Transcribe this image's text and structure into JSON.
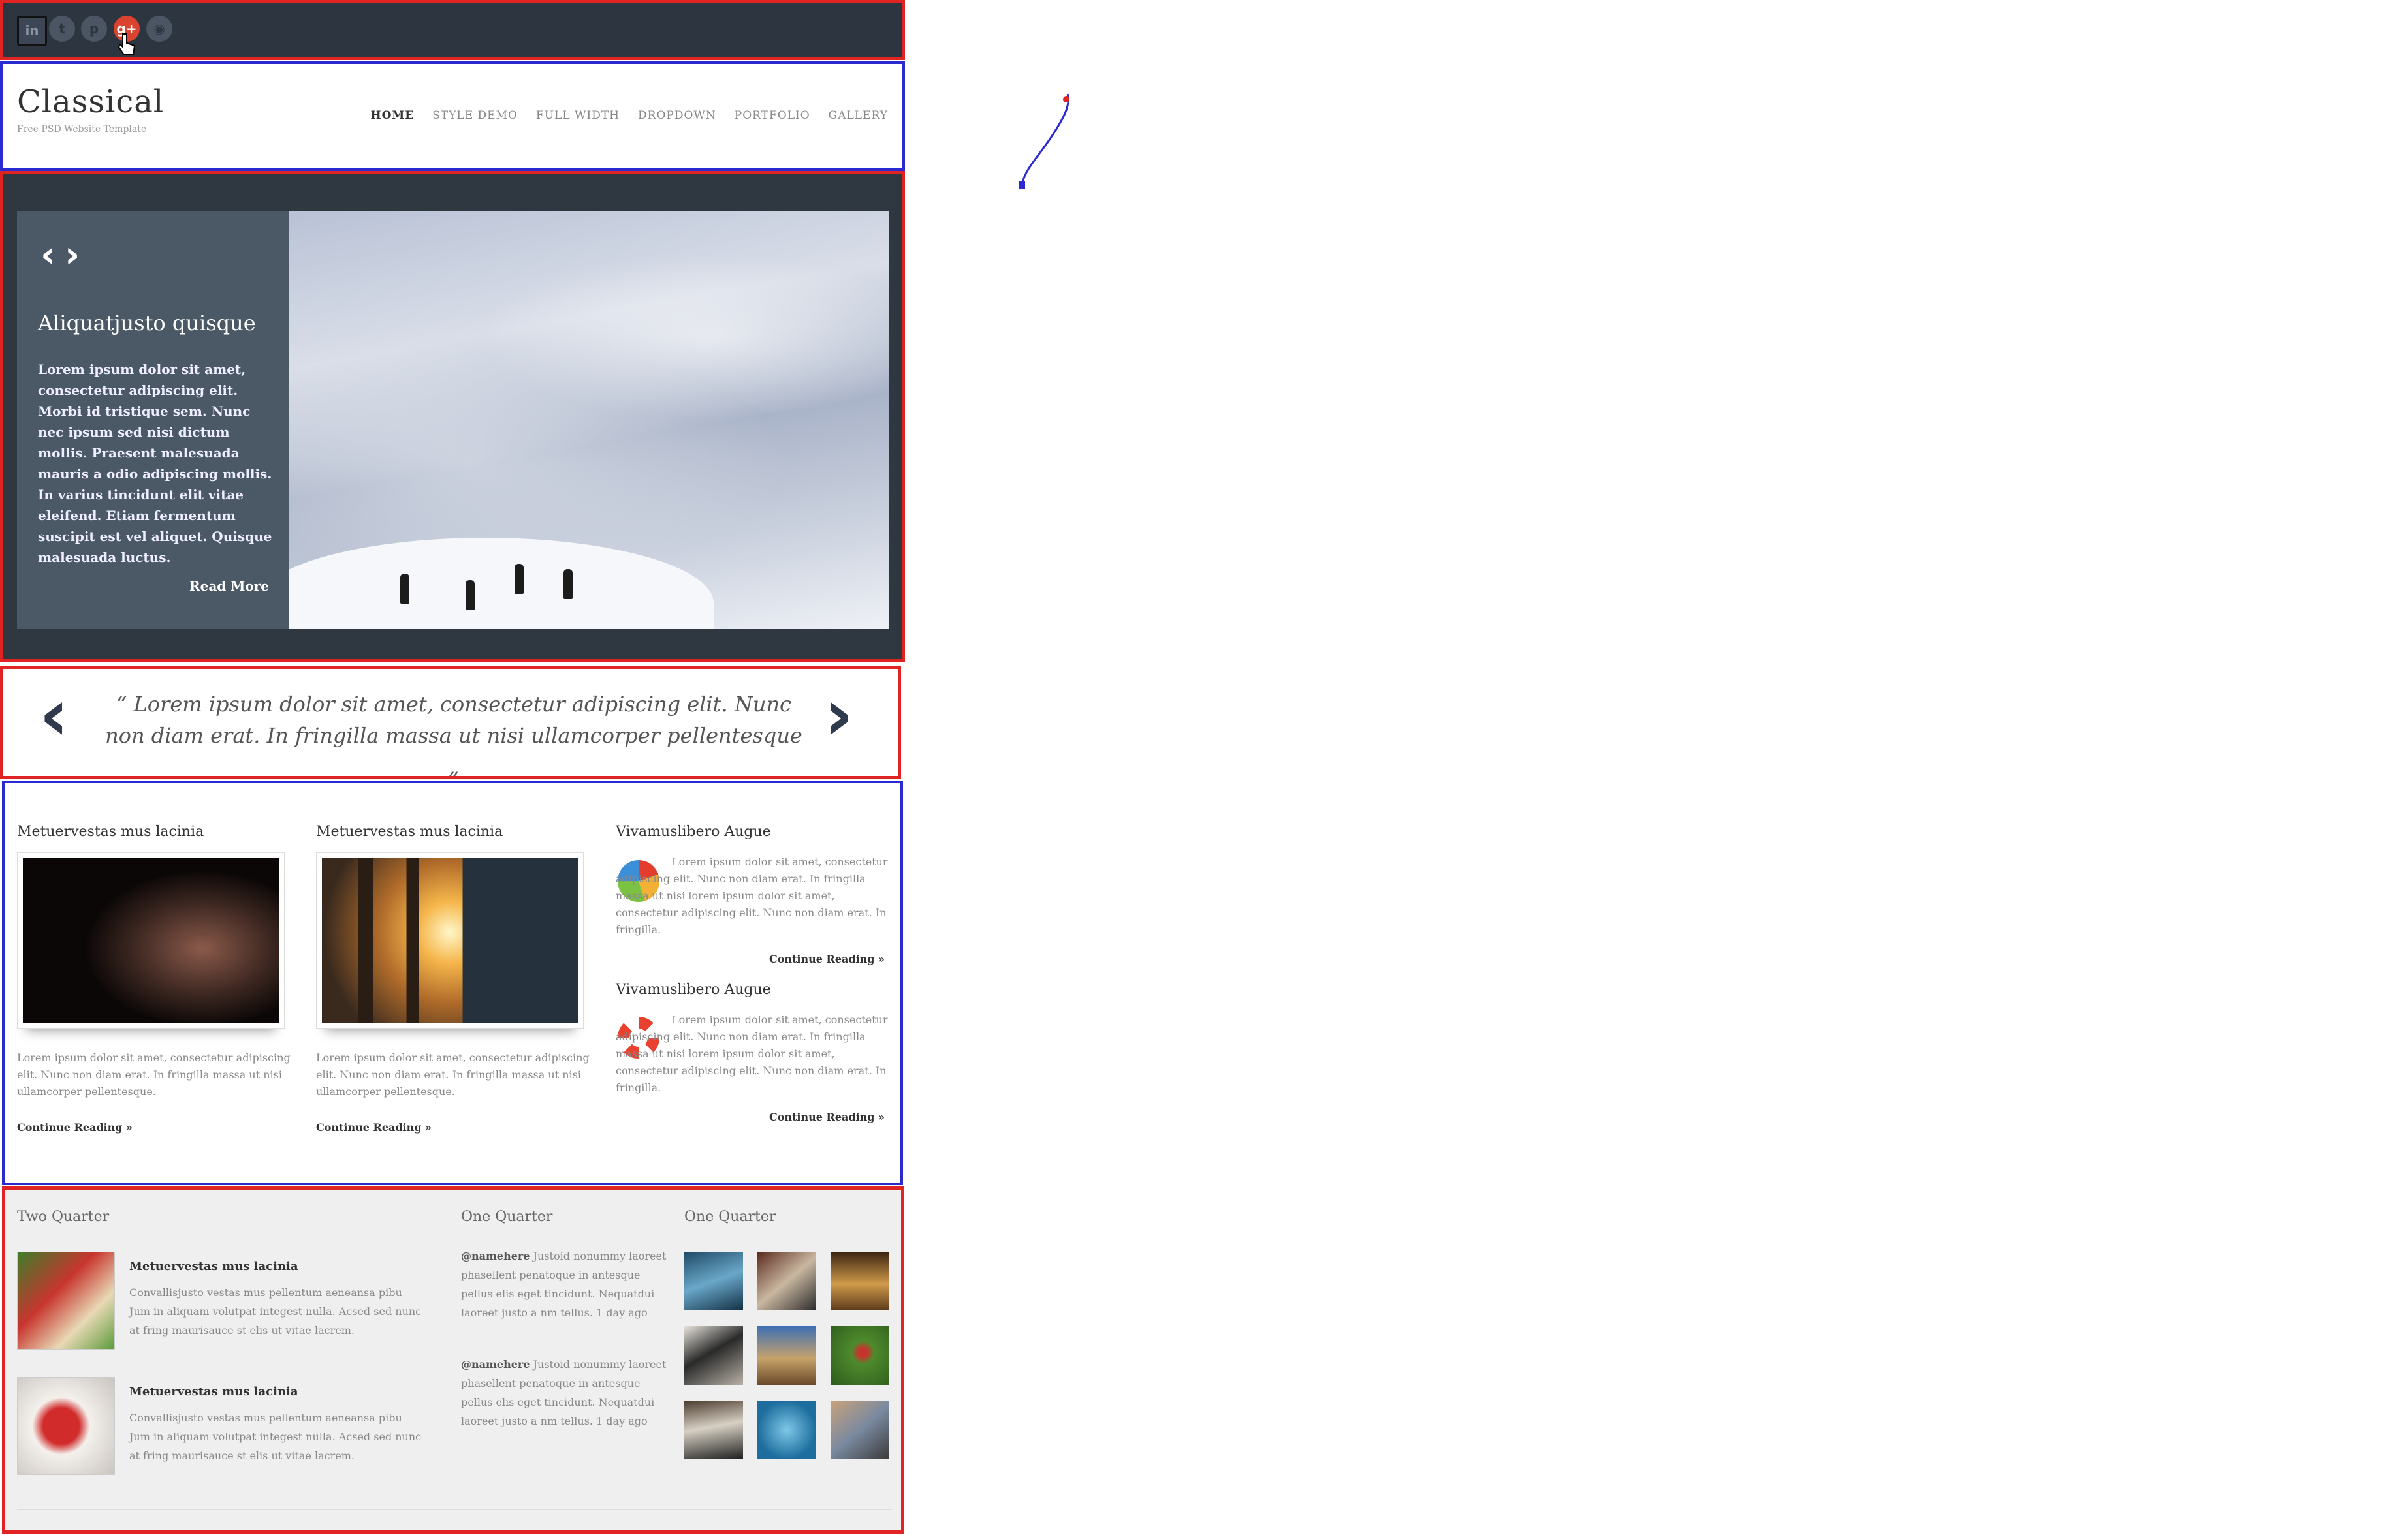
{
  "header": {
    "logo": "Classical",
    "tagline": "Free PSD Website Template",
    "nav": [
      "HOME",
      "STYLE DEMO",
      "FULL WIDTH",
      "DROPDOWN",
      "PORTFOLIO",
      "GALLERY"
    ]
  },
  "social": [
    "linkedin-icon",
    "twitter-icon",
    "pinterest-icon",
    "google-plus-icon",
    "rss-icon"
  ],
  "slider": {
    "title": "Aliquatjusto quisque",
    "text": "Lorem ipsum dolor sit amet, consectetur adipiscing elit. Morbi id tristique sem. Nunc nec ipsum sed nisi dictum mollis. Praesent malesuada mauris a odio adipiscing mollis. In varius tincidunt elit vitae eleifend. Etiam fermentum suscipit est vel aliquet. Quisque malesuada luctus.",
    "read_more": "Read More"
  },
  "quote": "“ Lorem ipsum dolor sit amet, consectetur adipiscing elit. Nunc non diam erat. In fringilla massa ut nisi ullamcorper pellentesque „",
  "columns": [
    {
      "title": "Metuervestas mus lacinia",
      "text": "Lorem ipsum dolor sit amet, consectetur adipiscing elit. Nunc non diam erat. In fringilla massa ut nisi ullamcorper pellentesque.",
      "more": "Continue Reading »"
    },
    {
      "title": "Metuervestas mus lacinia",
      "text": "Lorem ipsum dolor sit amet, consectetur adipiscing elit. Nunc non diam erat. In fringilla massa ut nisi ullamcorper pellentesque.",
      "more": "Continue Reading »"
    }
  ],
  "side_posts": [
    {
      "title": "Vivamuslibero Augue",
      "text": "Lorem ipsum dolor sit amet, consectetur adipiscing elit. Nunc non diam erat. In fringilla massa ut nisi lorem ipsum dolor sit amet, consectetur adipiscing elit. Nunc non diam erat. In fringilla.",
      "more": "Continue Reading »"
    },
    {
      "title": "Vivamuslibero Augue",
      "text": "Lorem ipsum dolor sit amet, consectetur adipiscing elit. Nunc non diam erat. In fringilla massa ut nisi lorem ipsum dolor sit amet, consectetur adipiscing elit. Nunc non diam erat. In fringilla.",
      "more": "Continue Reading »"
    }
  ],
  "footer": {
    "col1_title": "Two Quarter",
    "col2_title": "One Quarter",
    "col3_title": "One Quarter",
    "posts": [
      {
        "title": "Metuervestas mus lacinia",
        "text": "Convallisjusto vestas mus pellentum aeneansa pibu Jum in aliquam volutpat integest nulla. Acsed sed nunc at fring maurisauce st elis ut vitae lacrem."
      },
      {
        "title": "Metuervestas mus lacinia",
        "text": "Convallisjusto vestas mus pellentum aeneansa pibu Jum in aliquam volutpat integest nulla. Acsed sed nunc at fring maurisauce st elis ut vitae lacrem."
      }
    ],
    "tweets": [
      {
        "handle": "@namehere",
        "text": "Justoid nonummy laoreet phasellent penatoque in antesque pellus elis eget tincidunt. Nequatdui laoreet justo a nm tellus.",
        "time": "1 day ago"
      },
      {
        "handle": "@namehere",
        "text": "Justoid nonummy laoreet phasellent penatoque in antesque pellus elis eget tincidunt. Nequatdui laoreet justo a nm tellus.",
        "time": "1 day ago"
      }
    ]
  }
}
